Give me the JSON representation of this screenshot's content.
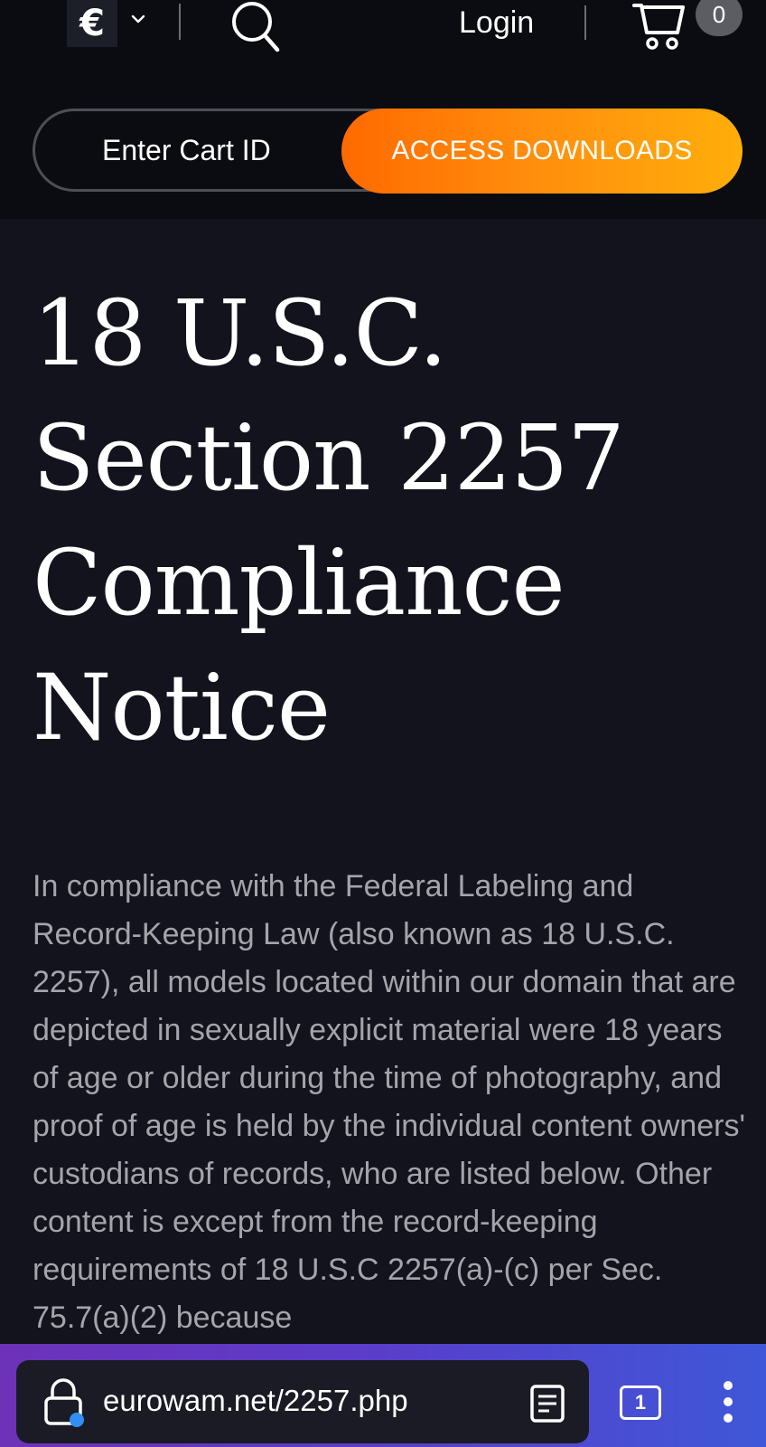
{
  "header": {
    "currency_symbol": "€",
    "login_label": "Login",
    "cart_count": "0"
  },
  "cart_form": {
    "input_placeholder": "Enter Cart ID",
    "button_label": "ACCESS DOWNLOADS"
  },
  "main": {
    "title": "18 U.S.C. Section 2257 Compliance Notice",
    "body": "In compliance with the Federal Labeling and Record-Keeping Law (also known as 18 U.S.C. 2257), all models located within our domain that are depicted in sexually explicit material were 18 years of age or older during the time of photography, and proof of age is held by the individual content owners' custodians of records, who are listed below. Other content is except from the record-keeping requirements of 18 U.S.C 2257(a)-(c) per Sec. 75.7(a)(2) because"
  },
  "browser": {
    "url": "eurowam.net/2257.php",
    "tab_count": "1"
  },
  "icons": {
    "currency_dropdown": "chevron-down-icon",
    "search": "search-icon",
    "cart": "cart-icon",
    "lock": "lock-icon",
    "reader": "reader-mode-icon",
    "menu": "more-vertical-icon"
  },
  "colors": {
    "header_bg": "#0b0c11",
    "page_bg": "#12131c",
    "accent_start": "#ff6a00",
    "accent_end": "#ffae0b",
    "browser_bar_start": "#6d32b8",
    "browser_bar_end": "#3f57d8"
  }
}
